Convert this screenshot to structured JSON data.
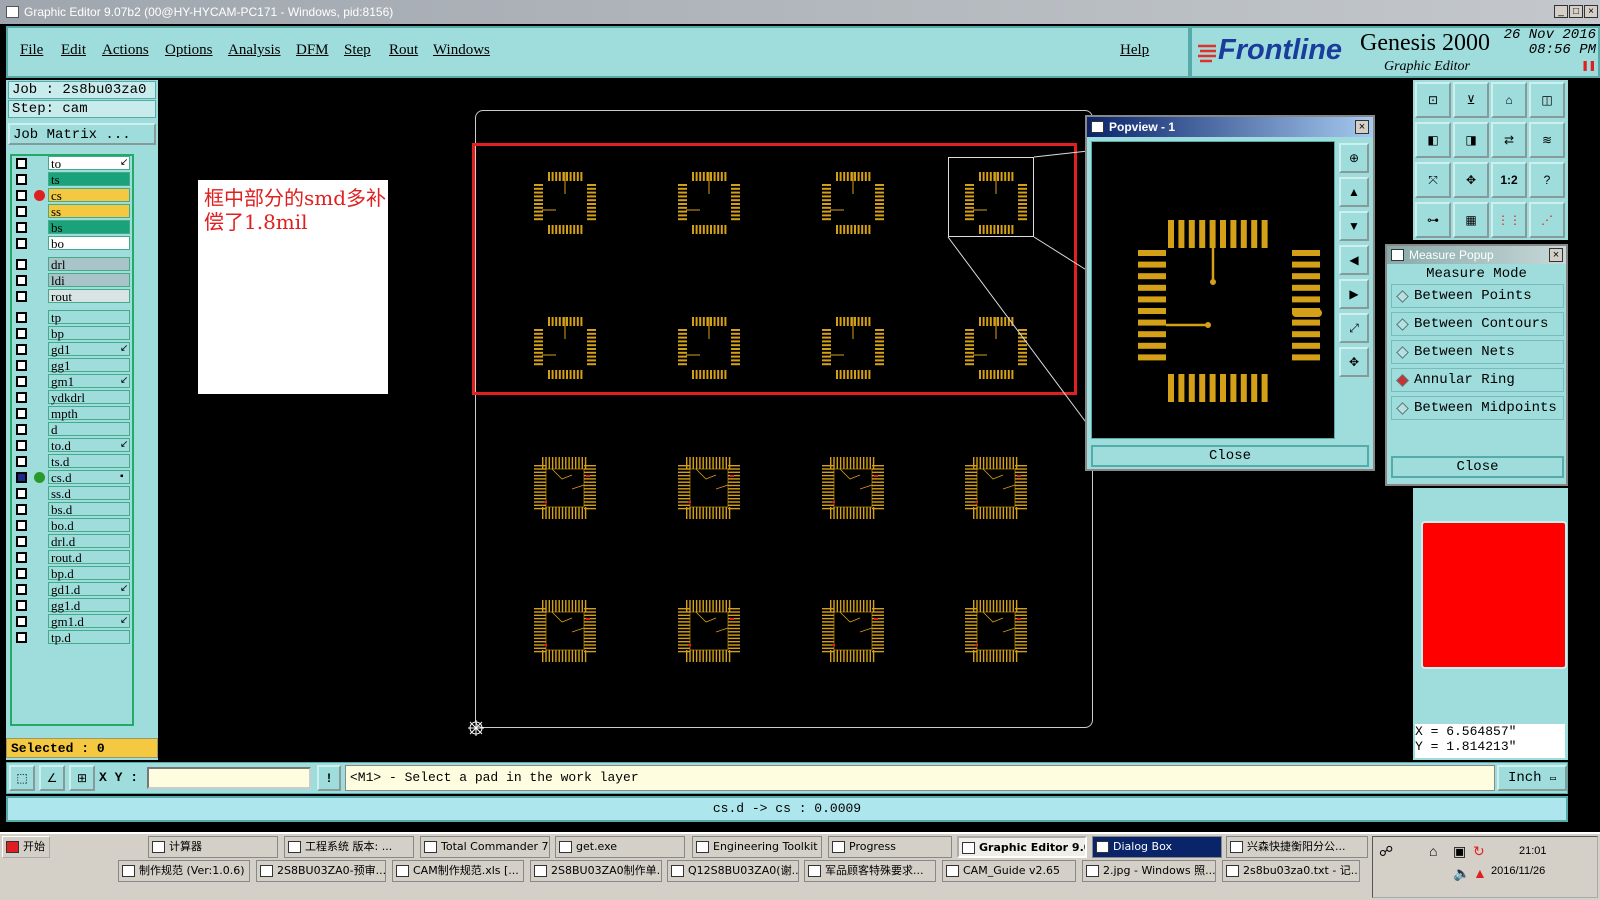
{
  "window": {
    "title": "Graphic Editor 9.07b2 (00@HY-HYCAM-PC171 - Windows, pid:8156)"
  },
  "menu": {
    "items": [
      "File",
      "Edit",
      "Actions",
      "Options",
      "Analysis",
      "DFM",
      "Step",
      "Rout",
      "Windows"
    ],
    "help": "Help"
  },
  "brand": {
    "frontline": "Frontline",
    "product": "Genesis 2000",
    "subtitle": "Graphic Editor",
    "date": "26 Nov 2016",
    "time": "08:56 PM"
  },
  "job": {
    "job_line": "Job : 2s8bu03za0",
    "step_line": "Step: cam",
    "matrix_button": "Job Matrix ..."
  },
  "layers": [
    {
      "name": "to",
      "color": "#ffffff",
      "flag": "↙"
    },
    {
      "name": "ts",
      "color": "#1aa37a",
      "flag": ""
    },
    {
      "name": "cs",
      "color": "#f5c842",
      "flag": "",
      "marker": "#e02020"
    },
    {
      "name": "ss",
      "color": "#f5c842",
      "flag": ""
    },
    {
      "name": "bs",
      "color": "#1aa37a",
      "flag": ""
    },
    {
      "name": "bo",
      "color": "#ffffff",
      "flag": ""
    },
    {
      "name": "drl",
      "color": "#a8c4c8",
      "flag": ""
    },
    {
      "name": "ldi",
      "color": "#a8c4c8",
      "flag": ""
    },
    {
      "name": "rout",
      "color": "#d8e4e4",
      "flag": ""
    },
    {
      "name": "tp",
      "color": "#9fdcdc",
      "flag": ""
    },
    {
      "name": "bp",
      "color": "#9fdcdc",
      "flag": ""
    },
    {
      "name": "gd1",
      "color": "#9fdcdc",
      "flag": "↙"
    },
    {
      "name": "gg1",
      "color": "#9fdcdc",
      "flag": ""
    },
    {
      "name": "gm1",
      "color": "#9fdcdc",
      "flag": "↙"
    },
    {
      "name": "ydkdrl",
      "color": "#9fdcdc",
      "flag": ""
    },
    {
      "name": "mpth",
      "color": "#9fdcdc",
      "flag": ""
    },
    {
      "name": "d",
      "color": "#9fdcdc",
      "flag": ""
    },
    {
      "name": "to.d",
      "color": "#9fdcdc",
      "flag": "↙"
    },
    {
      "name": "ts.d",
      "color": "#9fdcdc",
      "flag": ""
    },
    {
      "name": "cs.d",
      "color": "#9fdcdc",
      "flag": "▪",
      "marker": "#2a9a2a",
      "checked": true
    },
    {
      "name": "ss.d",
      "color": "#9fdcdc",
      "flag": ""
    },
    {
      "name": "bs.d",
      "color": "#9fdcdc",
      "flag": ""
    },
    {
      "name": "bo.d",
      "color": "#9fdcdc",
      "flag": ""
    },
    {
      "name": "drl.d",
      "color": "#9fdcdc",
      "flag": ""
    },
    {
      "name": "rout.d",
      "color": "#9fdcdc",
      "flag": ""
    },
    {
      "name": "bp.d",
      "color": "#9fdcdc",
      "flag": ""
    },
    {
      "name": "gd1.d",
      "color": "#9fdcdc",
      "flag": "↙"
    },
    {
      "name": "gg1.d",
      "color": "#9fdcdc",
      "flag": ""
    },
    {
      "name": "gm1.d",
      "color": "#9fdcdc",
      "flag": "↙"
    },
    {
      "name": "tp.d",
      "color": "#9fdcdc",
      "flag": ""
    }
  ],
  "selected_label": "Selected : 0",
  "note": {
    "text": "框中部分的smd多补偿了1.8mil"
  },
  "popview": {
    "title": "Popview - 1",
    "close_label": "Close"
  },
  "measure": {
    "title": "Measure Popup",
    "header": "Measure Mode",
    "modes": [
      {
        "label": "Between Points",
        "active": false
      },
      {
        "label": "Between Contours",
        "active": false
      },
      {
        "label": "Between Nets",
        "active": false
      },
      {
        "label": "Annular Ring",
        "active": true
      },
      {
        "label": "Between Midpoints",
        "active": false
      }
    ],
    "close_label": "Close"
  },
  "coords": {
    "x": "X = 6.564857\"",
    "y": "Y = 1.814213\""
  },
  "command": {
    "xy_label": "X Y :",
    "xy_value": "",
    "prompt": "<M1> - Select a pad in the work layer",
    "units": "Inch"
  },
  "status": {
    "text": "cs.d -> cs : 0.0009"
  },
  "taskbar": {
    "start": "开始",
    "row1": [
      "计算器",
      "工程系统 版本: ...",
      "Total Commander 7...",
      "get.exe",
      "Engineering Toolkit ...",
      "Progress",
      "Graphic Editor 9.0...",
      "Dialog Box",
      "兴森快捷衡阳分公..."
    ],
    "row2": [
      "制作规范 (Ver:1.0.6)",
      "2S8BU03ZA0-预审...",
      "CAM制作规范.xls [...",
      "2S8BU03ZA0制作单...",
      "Q12S8BU03ZA0(谢...",
      "军品顾客特殊要求...",
      "CAM_Guide v2.65",
      "2.jpg - Windows 照...",
      "2s8bu03za0.txt - 记..."
    ],
    "clock_time": "21:01",
    "clock_date": "2016/11/26"
  },
  "colors": {
    "panel": "#9fdcdc",
    "pad": "#d4a017",
    "red": "#e02020"
  }
}
